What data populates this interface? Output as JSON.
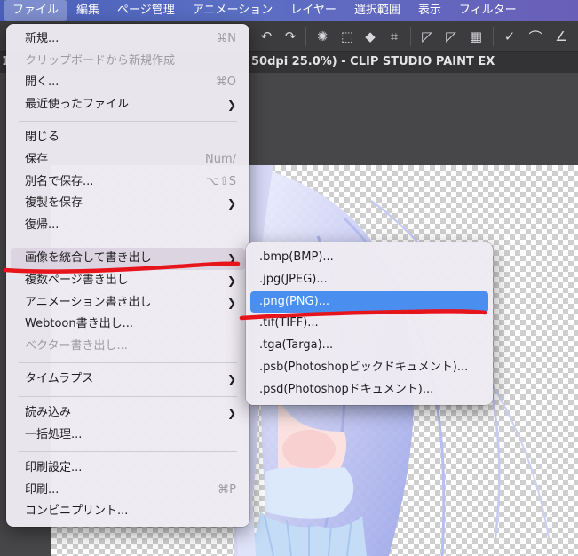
{
  "menubar": {
    "items": [
      {
        "label": "ファイル",
        "active": true
      },
      {
        "label": "編集"
      },
      {
        "label": "ページ管理"
      },
      {
        "label": "アニメーション"
      },
      {
        "label": "レイヤー"
      },
      {
        "label": "選択範囲"
      },
      {
        "label": "表示"
      },
      {
        "label": "フィルター"
      }
    ]
  },
  "window": {
    "title": "50dpi 25.0%) - CLIP STUDIO PAINT EX",
    "left_number": "1"
  },
  "file_menu": {
    "new": {
      "label": "新規...",
      "shortcut": "⌘N"
    },
    "new_from_clipboard": {
      "label": "クリップボードから新規作成"
    },
    "open": {
      "label": "開く...",
      "shortcut": "⌘O"
    },
    "recent": {
      "label": "最近使ったファイル",
      "arrow": "❯"
    },
    "close": {
      "label": "閉じる"
    },
    "save": {
      "label": "保存",
      "shortcut": "Num/"
    },
    "save_as": {
      "label": "別名で保存...",
      "shortcut": "⌥⇧S"
    },
    "save_copy": {
      "label": "複製を保存",
      "arrow": "❯"
    },
    "revert": {
      "label": "復帰..."
    },
    "export_flatten": {
      "label": "画像を統合して書き出し",
      "arrow": "❯"
    },
    "export_pages": {
      "label": "複数ページ書き出し",
      "arrow": "❯"
    },
    "export_animation": {
      "label": "アニメーション書き出し",
      "arrow": "❯"
    },
    "export_webtoon": {
      "label": "Webtoon書き出し..."
    },
    "export_vector": {
      "label": "ベクター書き出し..."
    },
    "timelapse": {
      "label": "タイムラプス",
      "arrow": "❯"
    },
    "import": {
      "label": "読み込み",
      "arrow": "❯"
    },
    "batch": {
      "label": "一括処理..."
    },
    "print_settings": {
      "label": "印刷設定..."
    },
    "print": {
      "label": "印刷...",
      "shortcut": "⌘P"
    },
    "convenience_print": {
      "label": "コンビニプリント..."
    }
  },
  "export_submenu": {
    "items": [
      {
        "label": ".bmp(BMP)..."
      },
      {
        "label": ".jpg(JPEG)..."
      },
      {
        "label": ".png(PNG)...",
        "selected": true
      },
      {
        "label": ".tif(TIFF)..."
      },
      {
        "label": ".tga(Targa)..."
      },
      {
        "label": ".psb(Photoshopビックドキュメント)..."
      },
      {
        "label": ".psd(Photoshopドキュメント)..."
      }
    ]
  },
  "colors": {
    "menubar": "#5266bd",
    "menu_bg": "#eeeaf2",
    "selected": "#4a8ef0",
    "annotation": "#e8141c"
  }
}
